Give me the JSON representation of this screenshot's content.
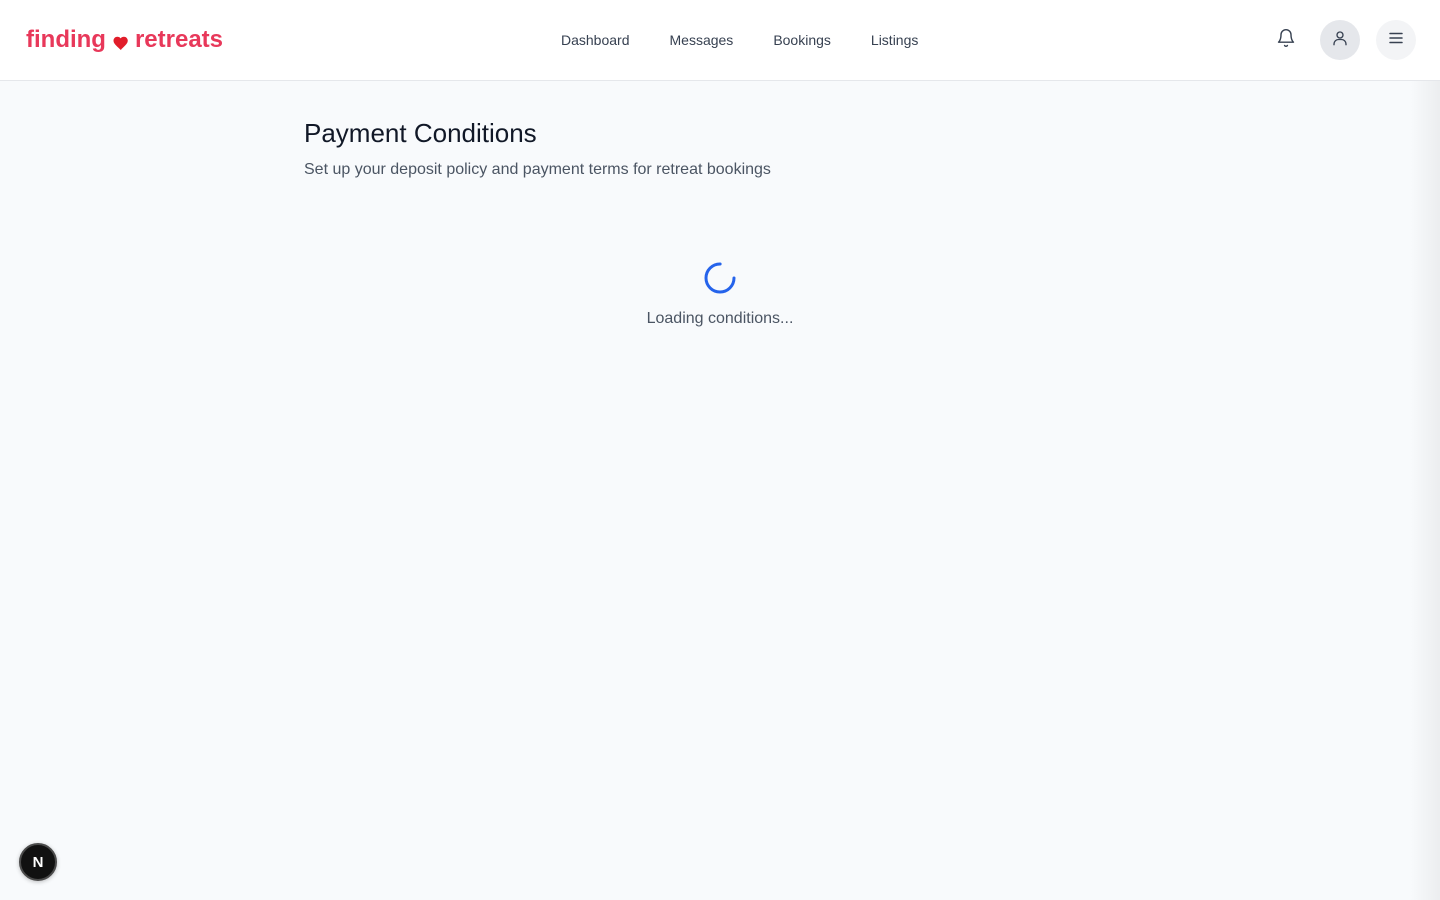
{
  "brand": {
    "name_left": "finding",
    "name_right": "retreats",
    "color": "#e8385a",
    "heart_color": "#e11d2a"
  },
  "nav": {
    "items": [
      {
        "label": "Dashboard"
      },
      {
        "label": "Messages"
      },
      {
        "label": "Bookings"
      },
      {
        "label": "Listings"
      }
    ]
  },
  "header_icons": {
    "notifications": "bell-icon",
    "profile": "user-icon",
    "menu": "hamburger-menu-icon"
  },
  "page": {
    "title": "Payment Conditions",
    "subtitle": "Set up your deposit policy and payment terms for retreat bookings"
  },
  "loading": {
    "text": "Loading conditions...",
    "spinner_color": "#2563eb"
  },
  "dev_badge": {
    "label": "N"
  }
}
